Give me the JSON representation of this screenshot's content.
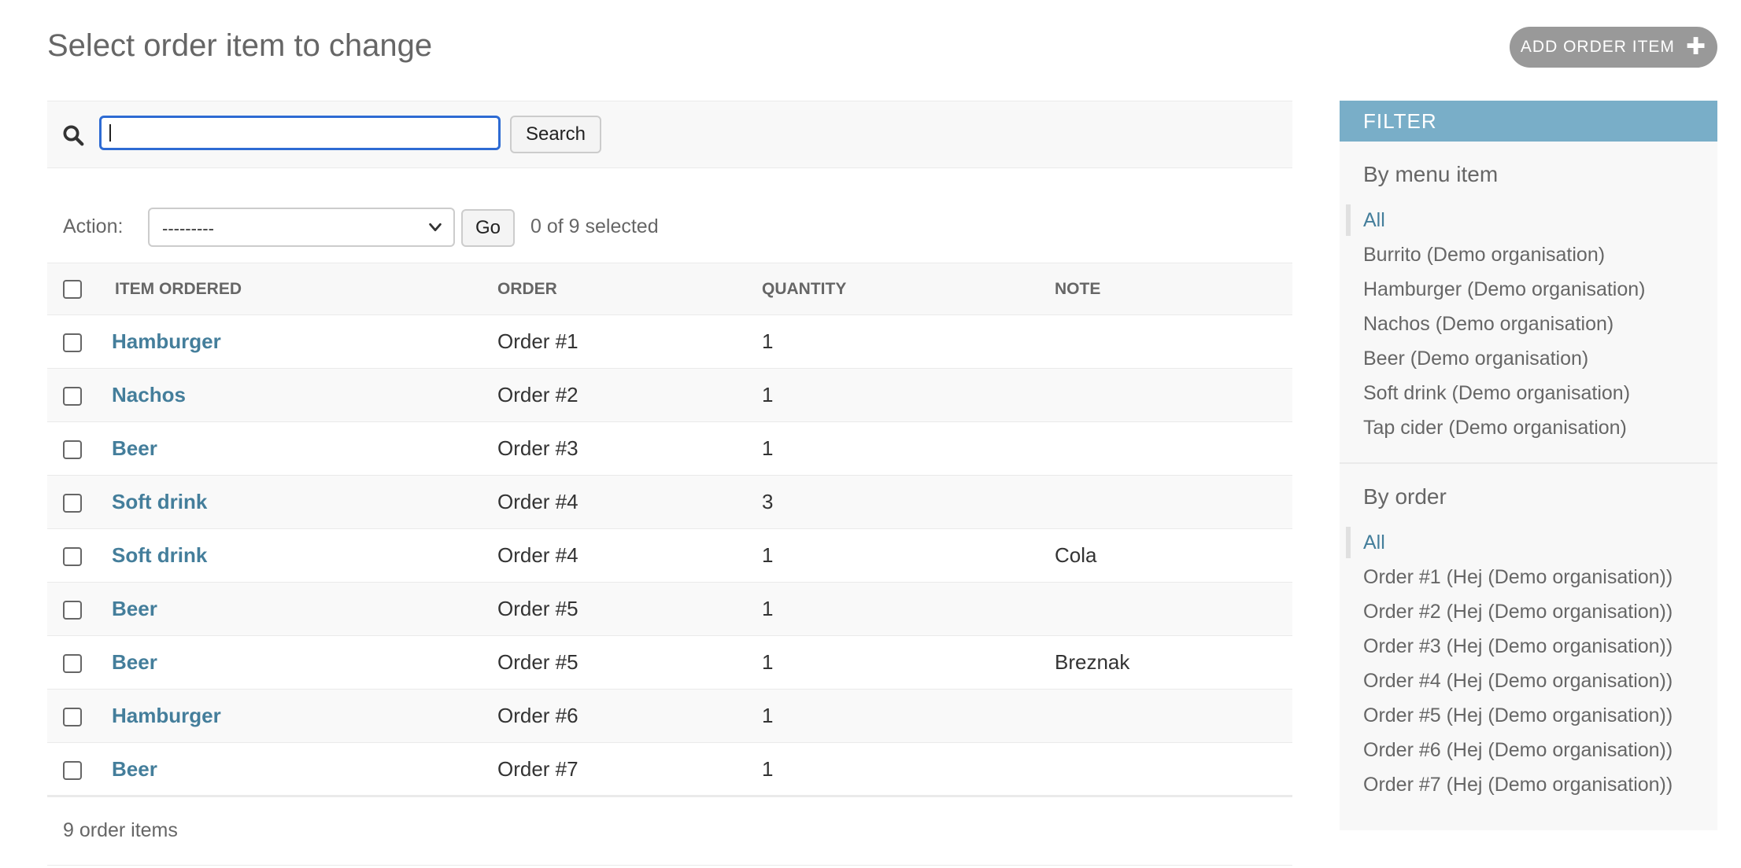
{
  "header": {
    "title": "Select order item to change",
    "add_button_label": "ADD ORDER ITEM",
    "add_button_icon": "plus-icon"
  },
  "search": {
    "value": "",
    "button_label": "Search",
    "icon": "search-icon"
  },
  "actions": {
    "label": "Action:",
    "selected_option": "---------",
    "go_label": "Go",
    "selected_count": "0 of 9 selected"
  },
  "table": {
    "columns": [
      "ITEM ORDERED",
      "ORDER",
      "QUANTITY",
      "NOTE"
    ],
    "rows": [
      {
        "item": "Hamburger",
        "order": "Order #1",
        "quantity": "1",
        "note": ""
      },
      {
        "item": "Nachos",
        "order": "Order #2",
        "quantity": "1",
        "note": ""
      },
      {
        "item": "Beer",
        "order": "Order #3",
        "quantity": "1",
        "note": ""
      },
      {
        "item": "Soft drink",
        "order": "Order #4",
        "quantity": "3",
        "note": ""
      },
      {
        "item": "Soft drink",
        "order": "Order #4",
        "quantity": "1",
        "note": "Cola"
      },
      {
        "item": "Beer",
        "order": "Order #5",
        "quantity": "1",
        "note": ""
      },
      {
        "item": "Beer",
        "order": "Order #5",
        "quantity": "1",
        "note": "Breznak"
      },
      {
        "item": "Hamburger",
        "order": "Order #6",
        "quantity": "1",
        "note": ""
      },
      {
        "item": "Beer",
        "order": "Order #7",
        "quantity": "1",
        "note": ""
      }
    ]
  },
  "paginator": {
    "text": "9 order items"
  },
  "filter": {
    "title": "FILTER",
    "groups": [
      {
        "title": "By menu item",
        "items": [
          "All",
          "Burrito (Demo organisation)",
          "Hamburger (Demo organisation)",
          "Nachos (Demo organisation)",
          "Beer (Demo organisation)",
          "Soft drink (Demo organisation)",
          "Tap cider (Demo organisation)"
        ]
      },
      {
        "title": "By order",
        "items": [
          "All",
          "Order #1 (Hej (Demo organisation))",
          "Order #2 (Hej (Demo organisation))",
          "Order #3 (Hej (Demo organisation))",
          "Order #4 (Hej (Demo organisation))",
          "Order #5 (Hej (Demo organisation))",
          "Order #6 (Hej (Demo organisation))",
          "Order #7 (Hej (Demo organisation))"
        ]
      }
    ]
  },
  "colors": {
    "link": "#447e9b",
    "filter_header": "#79aec8",
    "add_button": "#999999",
    "focus_border": "#2e6bd3"
  }
}
